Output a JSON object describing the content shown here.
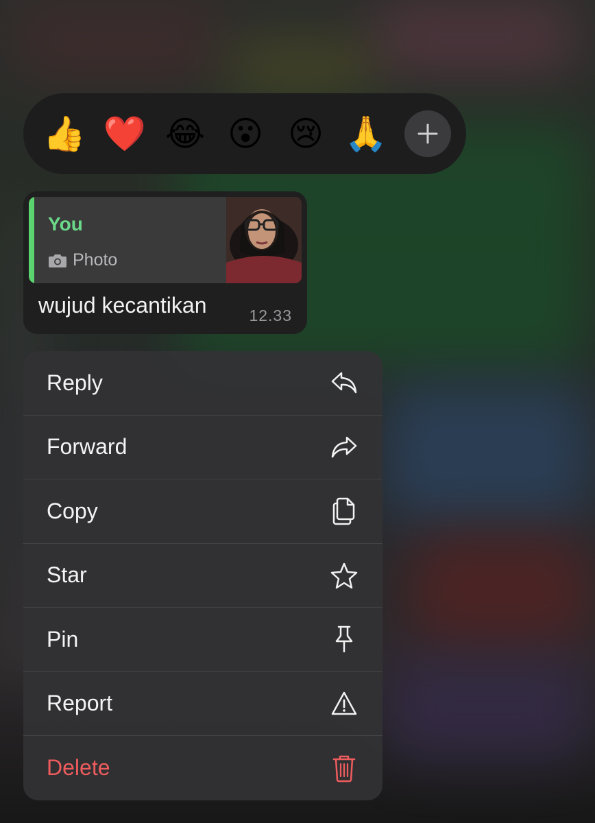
{
  "colors": {
    "accent_green": "#6bd989",
    "danger_red": "#ee5c5d",
    "menu_bg": "#323234",
    "bubble_bg": "#1f1f20"
  },
  "reactions": [
    {
      "emoji": "👍",
      "icon": "thumbs-up-icon"
    },
    {
      "emoji": "❤️",
      "icon": "red-heart-icon"
    },
    {
      "emoji": "😂",
      "icon": "tears-of-joy-icon"
    },
    {
      "emoji": "😮",
      "icon": "open-mouth-icon"
    },
    {
      "emoji": "😢",
      "icon": "crying-face-icon"
    },
    {
      "emoji": "🙏",
      "icon": "folded-hands-icon"
    }
  ],
  "message": {
    "quote_author": "You",
    "quote_type": "Photo",
    "text": "wujud kecantikan",
    "time": "12.33"
  },
  "menu": {
    "items": [
      {
        "label": "Reply",
        "icon": "reply-icon"
      },
      {
        "label": "Forward",
        "icon": "forward-icon"
      },
      {
        "label": "Copy",
        "icon": "copy-icon"
      },
      {
        "label": "Star",
        "icon": "star-icon"
      },
      {
        "label": "Pin",
        "icon": "pin-icon"
      },
      {
        "label": "Report",
        "icon": "warning-icon"
      },
      {
        "label": "Delete",
        "icon": "trash-icon"
      }
    ]
  }
}
